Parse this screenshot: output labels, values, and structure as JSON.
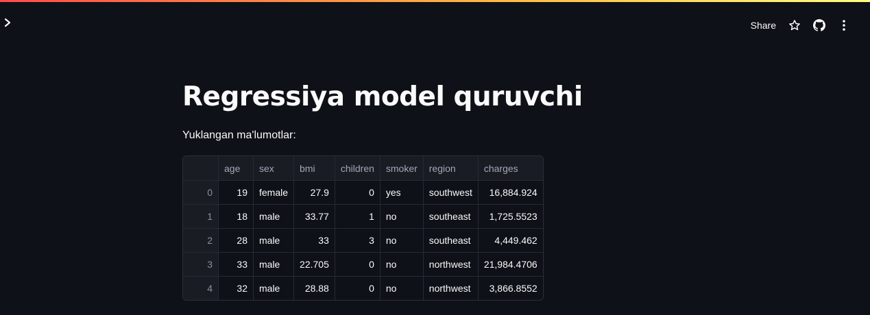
{
  "header": {
    "share_label": "Share",
    "icons": [
      "chevron-right-icon",
      "star-icon",
      "github-icon",
      "more-vertical-icon"
    ],
    "gradient_colors": [
      "#ff4b4b",
      "#ffbd45",
      "#fffd80"
    ]
  },
  "main": {
    "title": "Regressiya model quruvchi",
    "subtitle": "Yuklangan ma'lumotlar:"
  },
  "table": {
    "columns": [
      "",
      "age",
      "sex",
      "bmi",
      "children",
      "smoker",
      "region",
      "charges"
    ],
    "rows": [
      [
        "0",
        "19",
        "female",
        "27.9",
        "0",
        "yes",
        "southwest",
        "16,884.924"
      ],
      [
        "1",
        "18",
        "male",
        "33.77",
        "1",
        "no",
        "southeast",
        "1,725.5523"
      ],
      [
        "2",
        "28",
        "male",
        "33",
        "3",
        "no",
        "southeast",
        "4,449.462"
      ],
      [
        "3",
        "33",
        "male",
        "22.705",
        "0",
        "no",
        "northwest",
        "21,984.4706"
      ],
      [
        "4",
        "32",
        "male",
        "28.88",
        "0",
        "no",
        "northwest",
        "3,866.8552"
      ]
    ]
  },
  "colors": {
    "background": "#0e1117",
    "text": "#fafafa",
    "header_cell": "#1a1c24"
  }
}
